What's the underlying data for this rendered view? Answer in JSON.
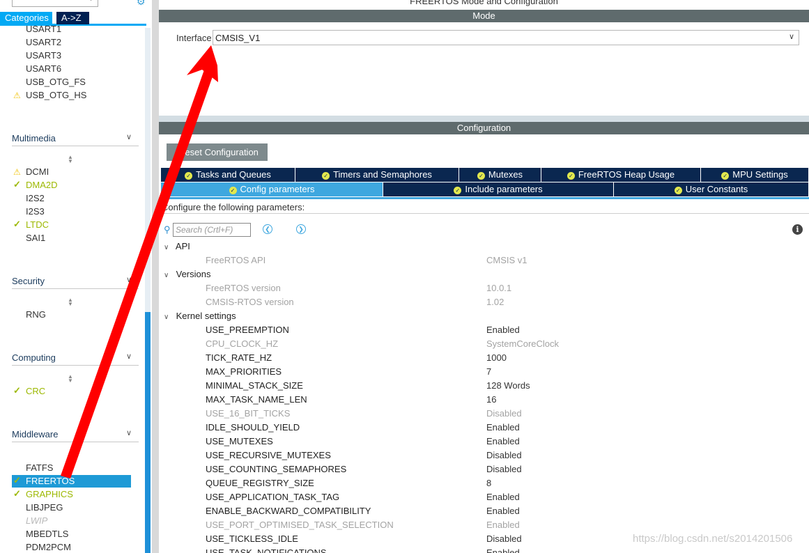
{
  "sidebar": {
    "tabs": {
      "categories": "Categories",
      "az": "A->Z"
    },
    "top_items": [
      {
        "label": "USART1",
        "status": "none"
      },
      {
        "label": "USART2",
        "status": "none"
      },
      {
        "label": "USART3",
        "status": "none"
      },
      {
        "label": "USART6",
        "status": "none"
      },
      {
        "label": "USB_OTG_FS",
        "status": "none"
      },
      {
        "label": "USB_OTG_HS",
        "status": "warning"
      }
    ],
    "categories": {
      "multimedia": {
        "title": "Multimedia",
        "items": [
          {
            "label": "DCMI",
            "status": "warning"
          },
          {
            "label": "DMA2D",
            "status": "enabled"
          },
          {
            "label": "I2S2",
            "status": "none"
          },
          {
            "label": "I2S3",
            "status": "none"
          },
          {
            "label": "LTDC",
            "status": "enabled"
          },
          {
            "label": "SAI1",
            "status": "none"
          }
        ]
      },
      "security": {
        "title": "Security",
        "items": [
          {
            "label": "RNG",
            "status": "none"
          }
        ]
      },
      "computing": {
        "title": "Computing",
        "items": [
          {
            "label": "CRC",
            "status": "enabled"
          }
        ]
      },
      "middleware": {
        "title": "Middleware",
        "items": [
          {
            "label": "FATFS",
            "status": "none"
          },
          {
            "label": "FREERTOS",
            "status": "selected"
          },
          {
            "label": "GRAPHICS",
            "status": "enabled"
          },
          {
            "label": "LIBJPEG",
            "status": "none"
          },
          {
            "label": "LWIP",
            "status": "disabled"
          },
          {
            "label": "MBEDTLS",
            "status": "none"
          },
          {
            "label": "PDM2PCM",
            "status": "none"
          }
        ]
      }
    }
  },
  "main": {
    "title": "FREERTOS Mode and Configuration",
    "mode": {
      "header": "Mode",
      "interface_label": "Interface",
      "interface_value": "CMSIS_V1"
    },
    "configuration": {
      "header": "Configuration",
      "reset_button": "Reset Configuration",
      "tabs_row1": [
        "Tasks and Queues",
        "Timers and Semaphores",
        "Mutexes",
        "FreeRTOS Heap Usage",
        "MPU Settings"
      ],
      "tabs_row2": [
        "Config parameters",
        "Include parameters",
        "User Constants"
      ],
      "active_tab": "Config parameters",
      "configure_label": "Configure the following parameters:",
      "search_placeholder": "Search (Crtl+F)",
      "groups": {
        "api": {
          "title": "API",
          "params": [
            {
              "name": "FreeRTOS API",
              "value": "CMSIS v1",
              "readonly": true
            }
          ]
        },
        "versions": {
          "title": "Versions",
          "params": [
            {
              "name": "FreeRTOS version",
              "value": "10.0.1",
              "readonly": true
            },
            {
              "name": "CMSIS-RTOS version",
              "value": "1.02",
              "readonly": true
            }
          ]
        },
        "kernel": {
          "title": "Kernel settings",
          "params": [
            {
              "name": "USE_PREEMPTION",
              "value": "Enabled",
              "readonly": false
            },
            {
              "name": "CPU_CLOCK_HZ",
              "value": "SystemCoreClock",
              "readonly": true
            },
            {
              "name": "TICK_RATE_HZ",
              "value": "1000",
              "readonly": false
            },
            {
              "name": "MAX_PRIORITIES",
              "value": "7",
              "readonly": false
            },
            {
              "name": "MINIMAL_STACK_SIZE",
              "value": "128 Words",
              "readonly": false
            },
            {
              "name": "MAX_TASK_NAME_LEN",
              "value": "16",
              "readonly": false
            },
            {
              "name": "USE_16_BIT_TICKS",
              "value": "Disabled",
              "readonly": true
            },
            {
              "name": "IDLE_SHOULD_YIELD",
              "value": "Enabled",
              "readonly": false
            },
            {
              "name": "USE_MUTEXES",
              "value": "Enabled",
              "readonly": false
            },
            {
              "name": "USE_RECURSIVE_MUTEXES",
              "value": "Disabled",
              "readonly": false
            },
            {
              "name": "USE_COUNTING_SEMAPHORES",
              "value": "Disabled",
              "readonly": false
            },
            {
              "name": "QUEUE_REGISTRY_SIZE",
              "value": "8",
              "readonly": false
            },
            {
              "name": "USE_APPLICATION_TASK_TAG",
              "value": "Enabled",
              "readonly": false
            },
            {
              "name": "ENABLE_BACKWARD_COMPATIBILITY",
              "value": "Enabled",
              "readonly": false
            },
            {
              "name": "USE_PORT_OPTIMISED_TASK_SELECTION",
              "value": "Enabled",
              "readonly": true
            },
            {
              "name": "USE_TICKLESS_IDLE",
              "value": "Disabled",
              "readonly": false
            },
            {
              "name": "USE_TASK_NOTIFICATIONS",
              "value": "Enabled",
              "readonly": false
            }
          ]
        }
      }
    }
  },
  "watermark": "https://blog.csdn.net/s2014201506",
  "colors": {
    "accent": "#03a9f4",
    "navy": "#0a2750",
    "enabled_green": "#9cb800",
    "warning_yellow": "#f1c40f",
    "section_bar": "#5f6b6d",
    "annotation_red": "#ff0000"
  }
}
